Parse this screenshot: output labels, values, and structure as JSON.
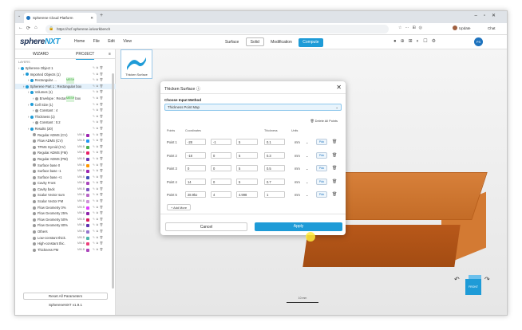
{
  "browser": {
    "tab_title": "Spherene Cloud Platform",
    "url": "https://ncf.spherene.io/workbench",
    "update_label": "Update",
    "chat_label": "Chat"
  },
  "app": {
    "logo_main": "sphere",
    "logo_accent": "NXT",
    "menu": [
      "Home",
      "File",
      "Edit",
      "View"
    ],
    "modes": [
      "Surface",
      "Solid",
      "Modification",
      "Compute"
    ],
    "active_mode": "Solid",
    "avatar": "PS"
  },
  "left_panel": {
    "tabs": [
      "WIZARD",
      "PROJECT"
    ],
    "layers_label": "LAYERS",
    "tree": [
      {
        "label": "Spherene Object 1",
        "indent": 0
      },
      {
        "label": "Imported Objects (1)",
        "indent": 1
      },
      {
        "label": "Rectangular ...",
        "indent": 2,
        "mini": "MESH"
      },
      {
        "label": "Spherene Part 1 : Rectangular box",
        "indent": 1,
        "selected": true
      },
      {
        "label": "Volumes (1)",
        "indent": 2
      },
      {
        "label": "Envelope : Rectangular box",
        "indent": 3,
        "mini": "MESH"
      },
      {
        "label": "Cell Size (1)",
        "indent": 2
      },
      {
        "label": "Constant : 4",
        "indent": 3
      },
      {
        "label": "Thickness (1)",
        "indent": 2
      },
      {
        "label": "Constant : 0.2",
        "indent": 3
      },
      {
        "label": "Results (20)",
        "indent": 2
      },
      {
        "label": "Regular ADMS (CV)",
        "indent": 3,
        "color": "#9c27b0"
      },
      {
        "label": "Flow ADMS (CV)",
        "indent": 3,
        "color": "#2196f3"
      },
      {
        "label": "TPMS Gyroid (CV)",
        "indent": 3,
        "color": "#4caf50"
      },
      {
        "label": "Regular ADMS (FM)",
        "indent": 3,
        "color": "#e91e63"
      },
      {
        "label": "Regular ADMS (PM)",
        "indent": 3,
        "color": "#673ab7"
      },
      {
        "label": "Surface base 0",
        "indent": 3,
        "color": "#ff9800"
      },
      {
        "label": "Surface base -1",
        "indent": 3,
        "color": "#9c27b0"
      },
      {
        "label": "Surface base +1",
        "indent": 3,
        "color": "#3f51b5"
      },
      {
        "label": "Cavity Front",
        "indent": 3,
        "color": "#ab47bc"
      },
      {
        "label": "Cavity back",
        "indent": 3,
        "color": "#7e57c2"
      },
      {
        "label": "Scalar Vector sum",
        "indent": 3,
        "color": "#ba68c8"
      },
      {
        "label": "Scalar Vector FM",
        "indent": 3,
        "color": "#ce93d8"
      },
      {
        "label": "Flow Geometry 0%",
        "indent": 3,
        "color": "#e040fb"
      },
      {
        "label": "Flow Geometry 25%",
        "indent": 3,
        "color": "#8e24aa"
      },
      {
        "label": "Flow Geometry 50%",
        "indent": 3,
        "color": "#d81b60"
      },
      {
        "label": "Flow Geometry 80%",
        "indent": 3,
        "color": "#5e35b1"
      },
      {
        "label": "Others",
        "indent": 3,
        "color": "#9575cd"
      },
      {
        "label": "Low-constant thick.",
        "indent": 3,
        "color": "#4db6ac"
      },
      {
        "label": "High-constant thic.",
        "indent": 3,
        "color": "#ec407a"
      },
      {
        "label": "Thickness PM",
        "indent": 3,
        "color": "#ab47bc"
      }
    ],
    "mini_tag": "MM.B",
    "reset_label": "Reset All Parameters",
    "version": "SphereneNXT v1.9.1"
  },
  "viewport": {
    "thumb_label": "Thicken Surface",
    "scale_label": "10 mm",
    "cube_label": "FRONT"
  },
  "dialog": {
    "title": "Thicken Surface",
    "method_label": "Choose Input Method",
    "method_value": "Thickness Point Map",
    "delete_all": "Delete All Points",
    "headers": [
      "Points",
      "Coordinates",
      "Thickness",
      "Units"
    ],
    "points": [
      {
        "name": "Point 1",
        "x": "-28",
        "y": "-1",
        "z": "5",
        "t": "0.1",
        "unit": "mm"
      },
      {
        "name": "Point 2",
        "x": "-18",
        "y": "0",
        "z": "5",
        "t": "0.3",
        "unit": "mm"
      },
      {
        "name": "Point 3",
        "x": "0",
        "y": "0",
        "z": "5",
        "t": "0.5",
        "unit": "mm"
      },
      {
        "name": "Point 4",
        "x": "14",
        "y": "0",
        "z": "5",
        "t": "0.7",
        "unit": "mm"
      },
      {
        "name": "Point 5",
        "x": "28.9ko",
        "y": "4",
        "z": "4.998",
        "t": "1",
        "unit": "mm"
      }
    ],
    "pick_label": "Pick",
    "add_more": "+ Add More",
    "cancel": "Cancel",
    "apply": "Apply"
  }
}
